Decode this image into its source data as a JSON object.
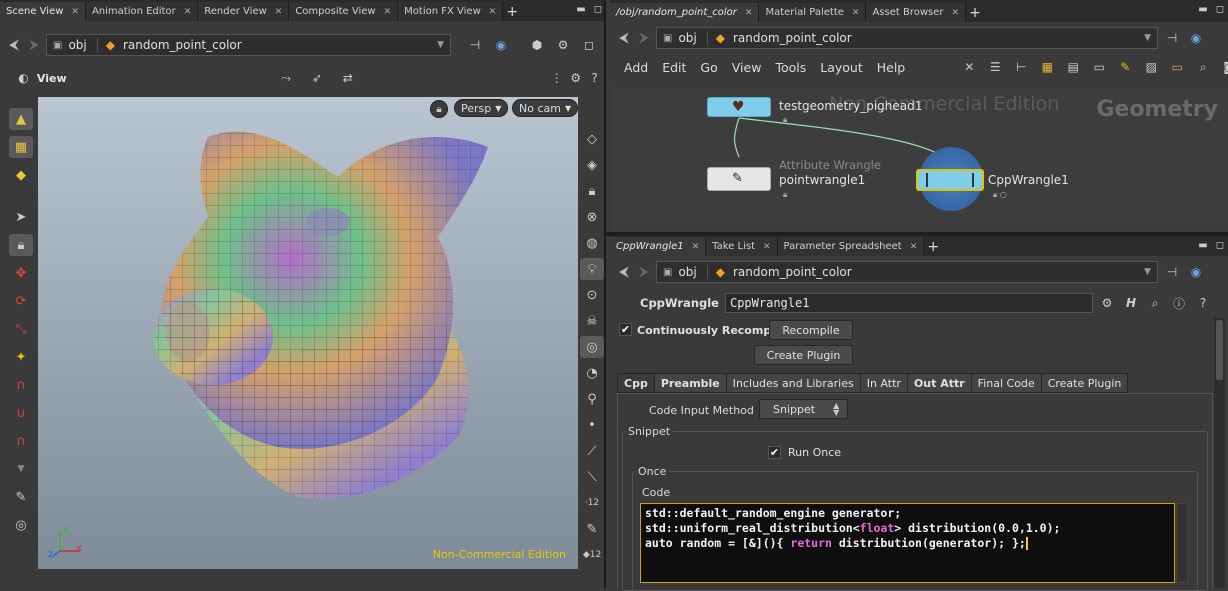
{
  "left_pane": {
    "tabs": [
      {
        "label": "Scene View"
      },
      {
        "label": "Animation Editor"
      },
      {
        "label": "Render View"
      },
      {
        "label": "Composite View"
      },
      {
        "label": "Motion FX View"
      }
    ],
    "path": {
      "root": "obj",
      "node": "random_point_color"
    },
    "view_label": "View",
    "camera_buttons": {
      "persp": "Persp",
      "cam": "No cam"
    },
    "watermark": "Non-Commercial Edition",
    "axis_labels": {
      "x": "x",
      "y": "y",
      "z": "z"
    }
  },
  "network_pane": {
    "tabs": [
      {
        "label": "/obj/random_point_color"
      },
      {
        "label": "Material Palette"
      },
      {
        "label": "Asset Browser"
      }
    ],
    "path": {
      "root": "obj",
      "node": "random_point_color"
    },
    "menu": [
      "Add",
      "Edit",
      "Go",
      "View",
      "Tools",
      "Layout",
      "Help"
    ],
    "watermark": "Non-Commercial Edition",
    "context_label": "Geometry",
    "nodes": {
      "geo": {
        "name": "testgeometry_pighead1"
      },
      "wrangle": {
        "type": "Attribute Wrangle",
        "name": "pointwrangle1"
      },
      "cpp": {
        "name": "CppWrangle1"
      }
    }
  },
  "parm_pane": {
    "tabs": [
      {
        "label": "CppWrangle1"
      },
      {
        "label": "Take List"
      },
      {
        "label": "Parameter Spreadsheet"
      }
    ],
    "path": {
      "root": "obj",
      "node": "random_point_color"
    },
    "node_type": "CppWrangle",
    "node_name": "CppWrangle1",
    "continuously_recompile": "Continuously Recompile",
    "recompile_button": "Recompile",
    "create_plugin_button": "Create Plugin",
    "subtabs": [
      "Cpp",
      "Preamble",
      "Includes and Libraries",
      "In Attr",
      "Out Attr",
      "Final Code",
      "Create Plugin"
    ],
    "code_input_method_label": "Code Input Method",
    "code_input_method_value": "Snippet",
    "snippet_group": "Snippet",
    "run_once_label": "Run Once",
    "once_group": "Once",
    "code_label": "Code",
    "code_lines": {
      "l1": "std::default_random_engine generator;",
      "l2a": "std::uniform_real_distribution<",
      "l2kw": "float",
      "l2b": "> distribution(0.0,1.0);",
      "l3a": "auto random = [&](){ ",
      "l3kw": "return",
      "l3b": " distribution(generator); };"
    }
  },
  "colors": {
    "accent_yellow": "#e6c100",
    "node_blue": "#7fcdeb",
    "keyword": "#e16bd8",
    "watermark_yellow": "#e8c800"
  }
}
